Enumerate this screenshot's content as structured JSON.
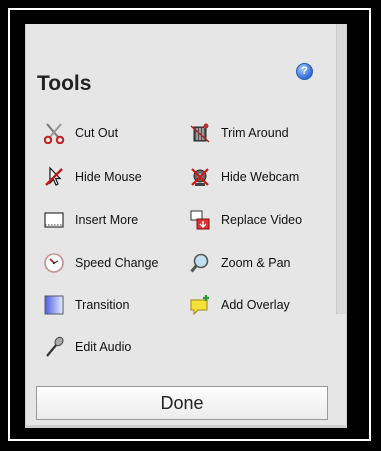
{
  "panel": {
    "title": "Tools",
    "help_icon": "question-icon",
    "help_glyph": "?",
    "tools": [
      {
        "label": "Cut Out",
        "icon": "scissors-icon"
      },
      {
        "label": "Trim Around",
        "icon": "trim-icon"
      },
      {
        "label": "Hide Mouse",
        "icon": "hide-mouse-icon"
      },
      {
        "label": "Hide Webcam",
        "icon": "hide-webcam-icon"
      },
      {
        "label": "Insert More",
        "icon": "insert-icon"
      },
      {
        "label": "Replace Video",
        "icon": "replace-video-icon"
      },
      {
        "label": "Speed Change",
        "icon": "speed-icon"
      },
      {
        "label": "Zoom & Pan",
        "icon": "magnifier-icon"
      },
      {
        "label": "Transition",
        "icon": "transition-icon"
      },
      {
        "label": "Add Overlay",
        "icon": "overlay-icon"
      },
      {
        "label": "Edit Audio",
        "icon": "microphone-icon"
      }
    ],
    "done_label": "Done"
  },
  "colors": {
    "panel_bg": "#e6e6e6",
    "help_blue": "#2f6fd8",
    "overlay_yellow": "#f5e13a",
    "transition_blue": "#4a5ee0"
  }
}
